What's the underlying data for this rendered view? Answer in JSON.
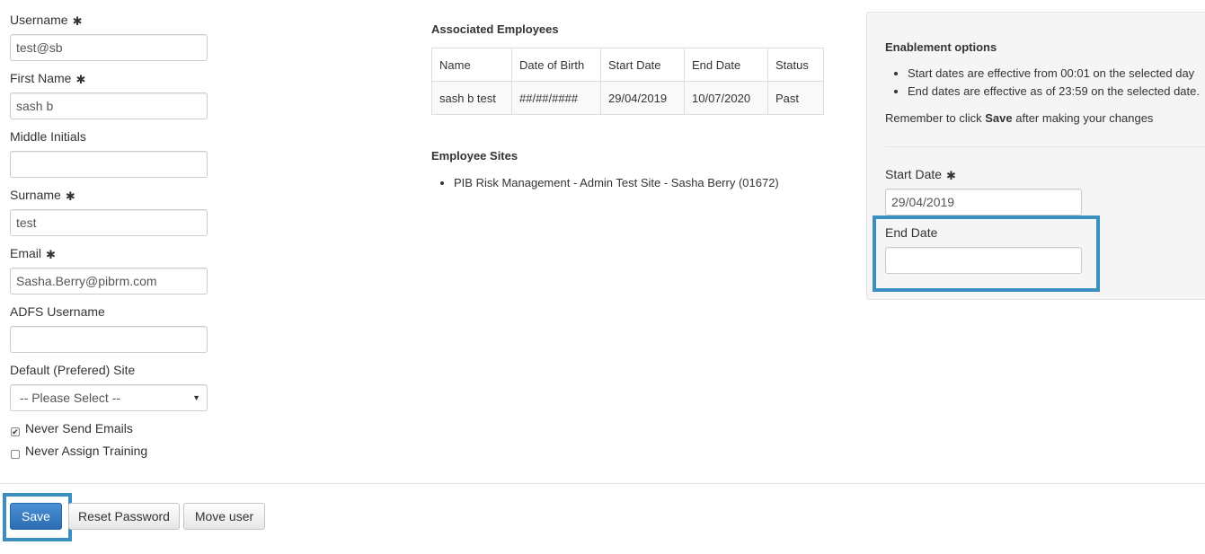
{
  "form": {
    "username": {
      "label": "Username",
      "value": "test@sb",
      "required_mark": "✱"
    },
    "first_name": {
      "label": "First Name",
      "value": "sash b",
      "required_mark": "✱"
    },
    "middle_initials": {
      "label": "Middle Initials",
      "value": ""
    },
    "surname": {
      "label": "Surname",
      "value": "test",
      "required_mark": "✱"
    },
    "email": {
      "label": "Email",
      "value": "Sasha.Berry@pibrm.com",
      "required_mark": "✱"
    },
    "adfs_username": {
      "label": "ADFS Username",
      "value": ""
    },
    "default_site": {
      "label": "Default (Prefered) Site",
      "selected": "-- Please Select --",
      "arrow": "▼"
    },
    "never_send_emails": {
      "label": "Never Send Emails",
      "checked": true,
      "check_glyph": "✔"
    },
    "never_assign_training": {
      "label": "Never Assign Training",
      "checked": false
    }
  },
  "associated_employees": {
    "heading": "Associated Employees",
    "columns": [
      "Name",
      "Date of Birth",
      "Start Date",
      "End Date",
      "Status"
    ],
    "rows": [
      [
        "sash b test",
        "##/##/####",
        "29/04/2019",
        "10/07/2020",
        "Past"
      ]
    ]
  },
  "employee_sites": {
    "heading": "Employee Sites",
    "items": [
      "PIB Risk Management - Admin Test Site - Sasha Berry (01672)"
    ]
  },
  "enablement": {
    "heading": "Enablement options",
    "bullets": [
      "Start dates are effective from 00:01 on the selected day",
      "End dates are effective as of 23:59 on the selected date."
    ],
    "reminder_prefix": "Remember to click ",
    "reminder_bold": "Save",
    "reminder_suffix": " after making your changes",
    "start_date": {
      "label": "Start Date",
      "value": "29/04/2019",
      "required_mark": "✱"
    },
    "end_date": {
      "label": "End Date",
      "value": ""
    }
  },
  "buttons": {
    "save": "Save",
    "reset_password": "Reset Password",
    "move_user": "Move user"
  },
  "colors": {
    "highlight": "#3a8fc0",
    "primary_button": "#2c6db3"
  }
}
